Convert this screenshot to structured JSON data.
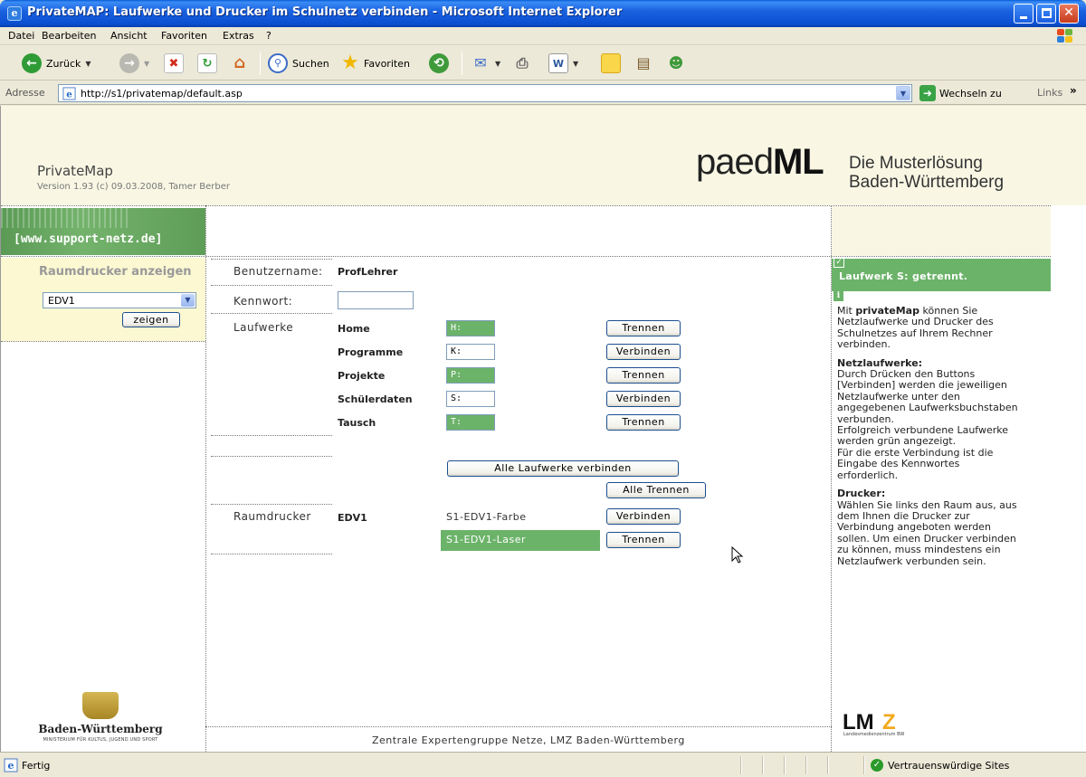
{
  "window": {
    "title": "PrivateMAP: Laufwerke und Drucker im Schulnetz verbinden - Microsoft Internet Explorer"
  },
  "menu": [
    "Datei",
    "Bearbeiten",
    "Ansicht",
    "Favoriten",
    "Extras",
    "?"
  ],
  "toolbar": {
    "back_label": "Zurück",
    "search_label": "Suchen",
    "favorites_label": "Favoriten"
  },
  "address": {
    "label": "Adresse",
    "url": "http://s1/privatemap/default.asp",
    "go_label": "Wechseln zu",
    "links_label": "Links"
  },
  "header": {
    "app_title": "PrivateMap",
    "version": "Version 1.93 (c) 09.03.2008, Tamer Berber",
    "logo_light": "paed",
    "logo_bold": "ML",
    "tagline_line1": "Die Musterlösung",
    "tagline_line2": "Baden-Württemberg"
  },
  "sidebar": {
    "banner": "[www.support-netz.de]",
    "heading": "Raumdrucker anzeigen",
    "room_select": "EDV1",
    "show_button": "zeigen",
    "state_logo": "Baden-Württemberg",
    "state_logo_sub": "MINISTERIUM FÜR KULTUS, JUGEND UND SPORT"
  },
  "form": {
    "username_label": "Benutzername:",
    "username_value": "ProfLehrer",
    "password_label": "Kennwort:",
    "password_value": "",
    "drives_label": "Laufwerke",
    "drives": [
      {
        "name": "Home",
        "letter": "H:",
        "connected": true,
        "button": "Trennen"
      },
      {
        "name": "Programme",
        "letter": "K:",
        "connected": false,
        "button": "Verbinden"
      },
      {
        "name": "Projekte",
        "letter": "P:",
        "connected": true,
        "button": "Trennen"
      },
      {
        "name": "Schülerdaten",
        "letter": "S:",
        "connected": false,
        "button": "Verbinden"
      },
      {
        "name": "Tausch",
        "letter": "T:",
        "connected": true,
        "button": "Trennen"
      }
    ],
    "connect_all_button": "Alle Laufwerke verbinden",
    "disconnect_all_button": "Alle Trennen",
    "printers_label": "Raumdrucker",
    "printer_room": "EDV1",
    "printers": [
      {
        "name": "S1-EDV1-Farbe",
        "connected": false,
        "button": "Verbinden"
      },
      {
        "name": "S1-EDV1-Laser",
        "connected": true,
        "button": "Trennen"
      }
    ],
    "footer": "Zentrale Expertengruppe Netze, LMZ Baden-Württemberg"
  },
  "info": {
    "status": "Laufwerk S: getrennt.",
    "intro_pre": "Mit ",
    "intro_bold": "privateMap",
    "intro_post": " können Sie Netzlaufwerke und Drucker des Schulnetzes auf Ihrem Rechner verbinden.",
    "drives_heading": "Netzlaufwerke:",
    "drives_text": "Durch Drücken den Buttons [Verbinden] werden die jeweiligen Netzlaufwerke unter den angegebenen Laufwerksbuchstaben verbunden.",
    "drives_text2": "Erfolgreich verbundene Laufwerke werden grün angezeigt.",
    "drives_text3": "Für die erste Verbindung ist die Eingabe des Kennwortes erforderlich.",
    "printers_heading": "Drucker:",
    "printers_text": "Wählen Sie links den Raum aus, aus dem Ihnen die Drucker zur Verbindung angeboten werden sollen. Um einen Drucker verbinden zu können, muss mindestens ein Netzlaufwerk verbunden sein.",
    "lmz_logo": "LMZ",
    "lmz_sub": "Landesmedienzentrum BW"
  },
  "statusbar": {
    "text": "Fertig",
    "zone": "Vertrauenswürdige Sites"
  },
  "colors": {
    "connected_green": "#6cb36a",
    "header_bg": "#f9f7e4",
    "sidebar_box_bg": "#fbf8d2",
    "xp_title_blue": "#0b4fd0"
  }
}
